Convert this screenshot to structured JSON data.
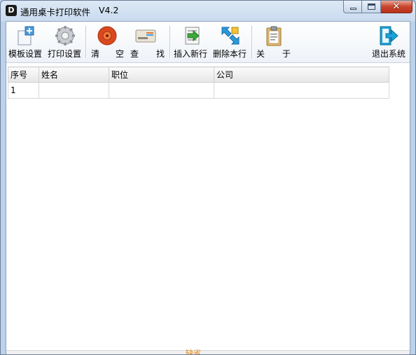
{
  "window": {
    "title": "通用桌卡打印软件",
    "version": "V4.2",
    "app_icon_letter": "D"
  },
  "caption": {
    "close_glyph": "✕"
  },
  "toolbar": {
    "template_settings": "模板设置",
    "print_settings": "打印设置",
    "clear_1": "清",
    "clear_2": "空",
    "find_1": "查",
    "find_2": "找",
    "insert_row": "插入新行",
    "delete_row": "删除本行",
    "about_1": "关",
    "about_2": "于",
    "exit": "退出系统"
  },
  "grid": {
    "columns": [
      "序号",
      "姓名",
      "职位",
      "公司"
    ],
    "rows": [
      [
        "1",
        "",
        "",
        ""
      ]
    ]
  },
  "status": {
    "text": "缺省"
  },
  "colors": {
    "accent_blue": "#1aa3d8",
    "clear_icon_red": "#d9481f",
    "status_orange": "#e38a1a"
  }
}
